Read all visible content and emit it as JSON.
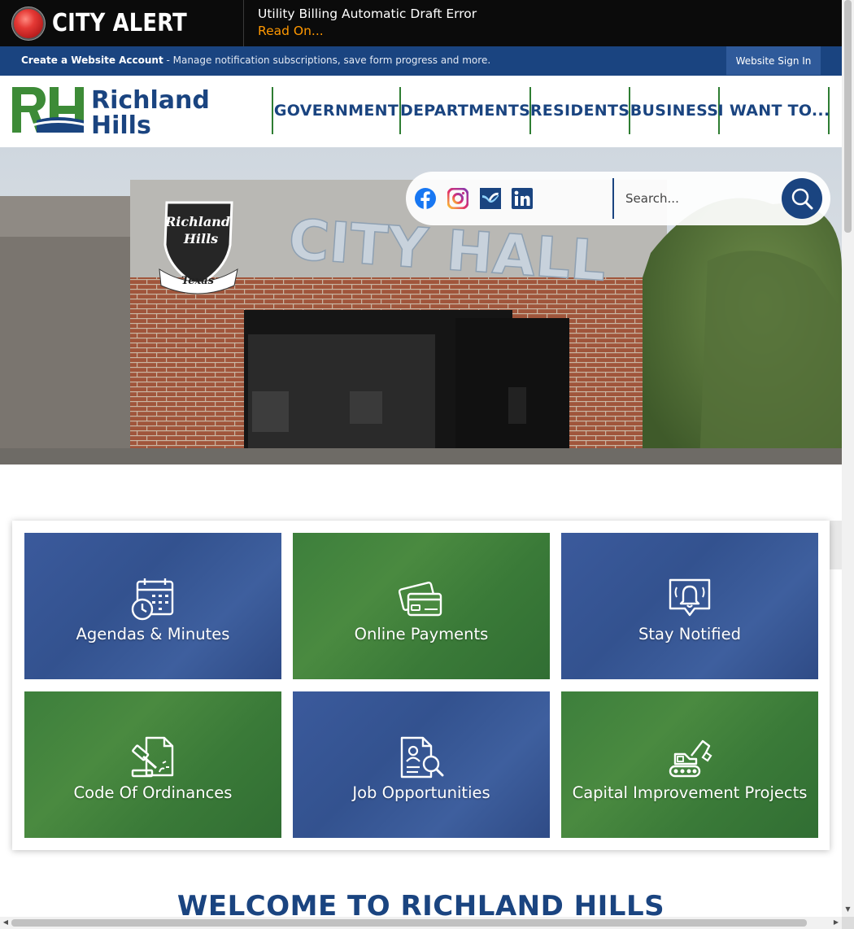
{
  "alert": {
    "title": "CITY ALERT",
    "message": "Utility Billing Automatic Draft Error",
    "read_on": "Read On..."
  },
  "account_bar": {
    "create_link": "Create a Website Account",
    "description": " - Manage notification subscriptions, save form progress and more.",
    "sign_in": "Website Sign In"
  },
  "logo": {
    "monogram": "RH",
    "line1": "Richland",
    "line2": "Hills"
  },
  "nav": {
    "items": [
      "GOVERNMENT",
      "DEPARTMENTS",
      "RESIDENTS",
      "BUSINESS",
      "I WANT TO..."
    ]
  },
  "hero": {
    "building_sign": "CITY HALL",
    "seal_line1": "Richland",
    "seal_line2": "Hills",
    "seal_ribbon": "Texas"
  },
  "search": {
    "placeholder": "Search..."
  },
  "social_icons": [
    "facebook-icon",
    "instagram-icon",
    "nextdoor-icon",
    "linkedin-icon"
  ],
  "tiles": [
    {
      "label": "Agendas & Minutes",
      "icon": "calendar-clock-icon",
      "color": "blue"
    },
    {
      "label": "Online Payments",
      "icon": "credit-card-icon",
      "color": "green"
    },
    {
      "label": "Stay Notified",
      "icon": "bell-notification-icon",
      "color": "blue"
    },
    {
      "label": "Code Of Ordinances",
      "icon": "gavel-document-icon",
      "color": "green"
    },
    {
      "label": "Job Opportunities",
      "icon": "document-search-icon",
      "color": "blue"
    },
    {
      "label": "Capital Improvement Projects",
      "icon": "excavator-icon",
      "color": "green"
    }
  ],
  "welcome": {
    "heading": "WELCOME TO RICHLAND HILLS"
  },
  "colors": {
    "primary_blue": "#1a4480",
    "primary_green": "#2e7d32",
    "alert_orange": "#ff9800",
    "alert_bg": "#0b0b0b"
  }
}
